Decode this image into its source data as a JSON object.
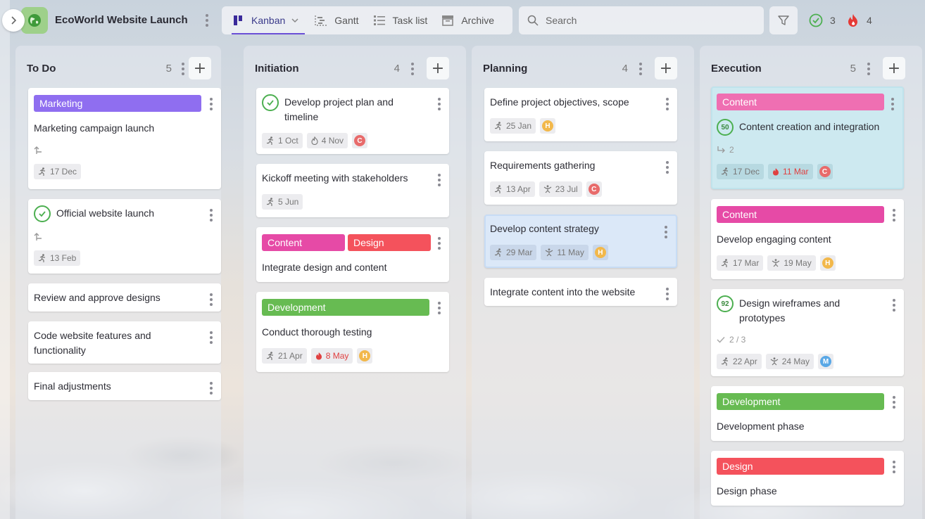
{
  "app": {
    "project_title": "EcoWorld Website Launch",
    "views": [
      {
        "label": "Kanban",
        "icon": "kanban-icon",
        "active": true
      },
      {
        "label": "Gantt",
        "icon": "gantt-icon"
      },
      {
        "label": "Task list",
        "icon": "task-list-icon"
      },
      {
        "label": "Archive",
        "icon": "archive-icon"
      }
    ],
    "search_placeholder": "Search",
    "completed_count": "3",
    "overdue_count": "4",
    "accent": "#6a4fd6"
  },
  "columns": [
    {
      "title": "To Do",
      "count": "5",
      "cards": [
        {
          "tags": [
            "Marketing"
          ],
          "title": "Marketing campaign launch",
          "start": "17 Dec"
        },
        {
          "title": "Official website launch",
          "start": "13 Feb"
        },
        {
          "title": "Review and approve designs"
        },
        {
          "title": "Code website features and functionality"
        },
        {
          "title": "Final adjustments"
        }
      ]
    },
    {
      "title": "Initiation",
      "count": "4",
      "cards": [
        {
          "title": "Develop project plan and timeline",
          "start": "1 Oct",
          "due": "4 Nov",
          "avatar": "C"
        },
        {
          "title": "Kickoff meeting with stakeholders",
          "start": "5 Jun"
        },
        {
          "tags": [
            "Content",
            "Design"
          ],
          "title": "Integrate design and content"
        },
        {
          "tags": [
            "Development"
          ],
          "title": "Conduct thorough testing",
          "start": "21 Apr",
          "due": "8 May",
          "avatar": "H"
        }
      ]
    },
    {
      "title": "Planning",
      "count": "4",
      "cards": [
        {
          "title": "Define project objectives, scope",
          "start": "25 Jan",
          "avatar": "H"
        },
        {
          "title": "Requirements gathering",
          "start": "13 Apr",
          "due": "23 Jul",
          "avatar": "C"
        },
        {
          "title": "Develop content strategy",
          "start": "29 Mar",
          "due": "11 May",
          "avatar": "H"
        },
        {
          "title": "Integrate content into the website"
        }
      ]
    },
    {
      "title": "Execution",
      "count": "5",
      "cards": [
        {
          "tags": [
            "Content"
          ],
          "progress": "50",
          "title": "Content creation and integration",
          "subtasks": "2",
          "start": "17 Dec",
          "due": "11 Mar",
          "avatar": "C"
        },
        {
          "tags": [
            "Content"
          ],
          "title": "Develop engaging content",
          "start": "17 Mar",
          "due": "19 May",
          "avatar": "H"
        },
        {
          "progress": "92",
          "title": "Design wireframes and prototypes",
          "checklist": "2 / 3",
          "start": "22 Apr",
          "due": "24 May",
          "avatar": "M"
        },
        {
          "tags": [
            "Development"
          ],
          "title": "Development phase"
        },
        {
          "tags": [
            "Design"
          ],
          "title": "Design phase"
        }
      ]
    }
  ]
}
